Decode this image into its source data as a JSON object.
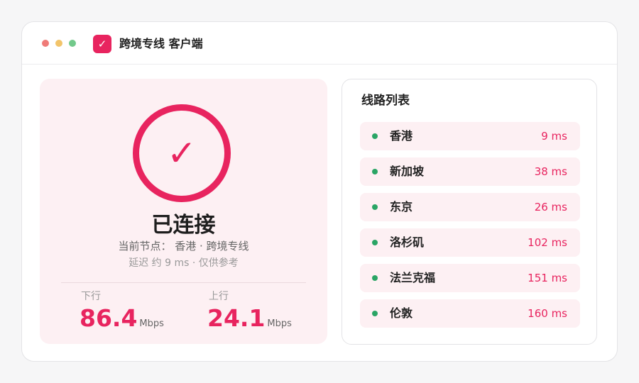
{
  "window": {
    "app_icon": "✓",
    "title": "跨境专线 客户端"
  },
  "status": {
    "check_glyph": "✓",
    "title": "已连接",
    "node_line": "当前节点： 香港 · 跨境专线",
    "latency_line": "延迟 约 9 ms · 仅供参考",
    "download": {
      "label": "下行",
      "value": "86.4",
      "unit": "Mbps"
    },
    "upload": {
      "label": "上行",
      "value": "24.1",
      "unit": "Mbps"
    }
  },
  "routes": {
    "title": "线路列表",
    "items": [
      {
        "name": "香港",
        "latency": "9 ms"
      },
      {
        "name": "新加坡",
        "latency": "38 ms"
      },
      {
        "name": "东京",
        "latency": "26 ms"
      },
      {
        "name": "洛杉矶",
        "latency": "102 ms"
      },
      {
        "name": "法兰克福",
        "latency": "151 ms"
      },
      {
        "name": "伦敦",
        "latency": "160 ms"
      }
    ]
  },
  "colors": {
    "accent": "#e8245f",
    "online": "#2aa565",
    "card_bg": "#fdf0f3"
  }
}
